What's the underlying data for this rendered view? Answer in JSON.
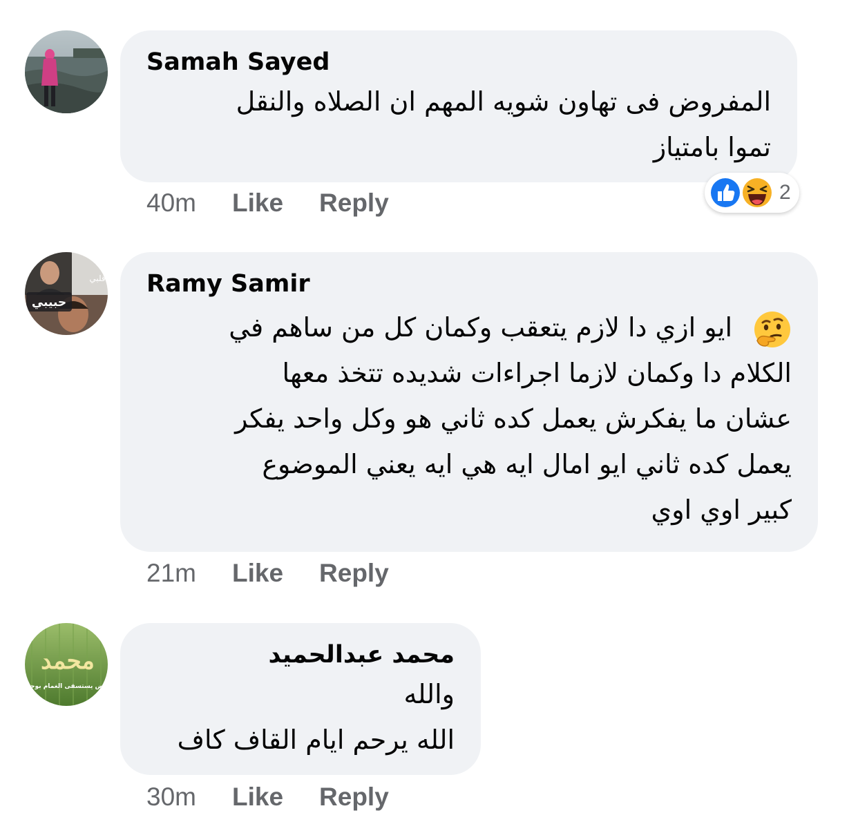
{
  "comments": [
    {
      "author": "Samah Sayed",
      "lines": [
        "المفروض فى تهاون شويه المهم ان الصلاه  والنقل",
        "تموا بامتياز"
      ],
      "time": "40m",
      "like_label": "Like",
      "reply_label": "Reply",
      "reactions": {
        "icons": [
          "like-icon",
          "haha-icon"
        ],
        "count": "2"
      }
    },
    {
      "author": "Ramy Samir",
      "lines": [
        "ايو ازي دا لازم يتعقب وكمان كل من ساهم في",
        "الكلام دا وكمان لازما اجراءات شديده تتخذ معها",
        "عشان ما يفكرش يعمل كده ثاني هو وكل واحد يفكر",
        "يعمل كده ثاني ايو امال ايه هي ايه يعني الموضوع",
        "كبير اوي اوي"
      ],
      "emoji": "thinking-face-icon",
      "time": "21m",
      "like_label": "Like",
      "reply_label": "Reply",
      "avatar_text": [
        "قلبي",
        "حبيبي"
      ]
    },
    {
      "author": "محمد عبدالحميد",
      "lines": [
        "والله",
        "الله يرحم ايام القاف كاف"
      ],
      "time": "30m",
      "like_label": "Like",
      "reply_label": "Reply",
      "avatar_text": [
        "محمد",
        "فيض يستسقى الغمام بوجهه"
      ]
    }
  ],
  "colors": {
    "bubble": "#f0f2f5",
    "text": "#050505",
    "meta": "#65676b",
    "like_blue": "#1877f2",
    "haha_yellow": "#f7b125"
  }
}
